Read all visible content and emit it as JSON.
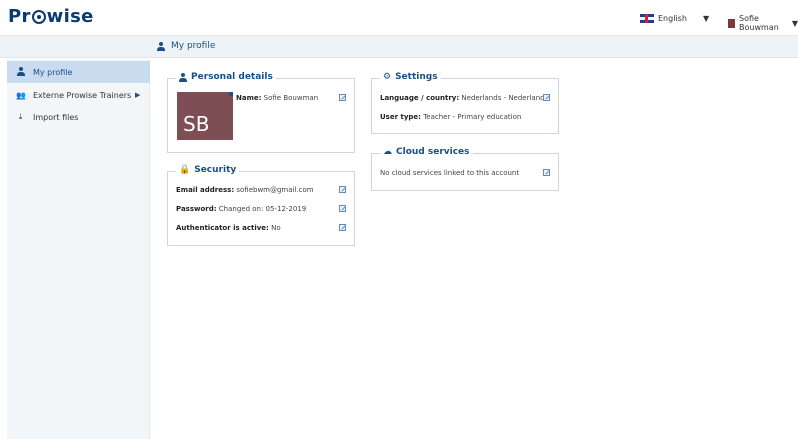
{
  "header": {
    "logo": "Pr wise",
    "logo_parts": [
      "Pr",
      "wise"
    ],
    "language": "English",
    "user_name": "Sofie Bouwman"
  },
  "subbar": {
    "title": "My profile"
  },
  "sidebar": {
    "items": [
      {
        "label": "My profile",
        "icon": "person-icon",
        "active": true
      },
      {
        "label": "Externe Prowise Trainers",
        "icon": "group-icon",
        "active": false
      },
      {
        "label": "Import files",
        "icon": "import-icon",
        "active": false
      }
    ]
  },
  "personal": {
    "title": "Personal details",
    "avatar_initials": "SB",
    "name_label": "Name:",
    "name_value": "Sofie Bouwman"
  },
  "security": {
    "title": "Security",
    "email_label": "Email address:",
    "email_value": "sofiebwm@gmail.com",
    "password_label": "Password:",
    "password_value": "Changed on: 05-12-2019",
    "auth_label": "Authenticator is active:",
    "auth_value": "No"
  },
  "settings": {
    "title": "Settings",
    "lang_label": "Language / country:",
    "lang_value": "Nederlands - Nederland",
    "usertype_label": "User type:",
    "usertype_value": "Teacher - Primary education"
  },
  "cloud": {
    "title": "Cloud services",
    "text": "No cloud services linked to this account"
  },
  "colors": {
    "brand": "#0b3b6e",
    "accent": "#1a4f87",
    "active_bg": "#c9dcef",
    "avatar_bg": "#7d4f54"
  }
}
